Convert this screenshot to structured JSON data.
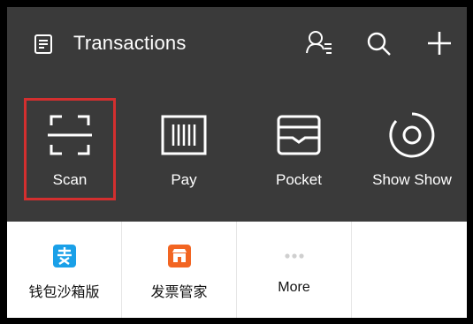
{
  "header": {
    "title": "Transactions",
    "icons": [
      "document-icon",
      "contacts-icon",
      "search-icon",
      "plus-icon"
    ]
  },
  "quick_actions": [
    {
      "label": "Scan",
      "icon": "scan-icon",
      "highlighted": true
    },
    {
      "label": "Pay",
      "icon": "barcode-icon"
    },
    {
      "label": "Pocket",
      "icon": "wallet-icon"
    },
    {
      "label": "Show Show",
      "icon": "show-icon"
    }
  ],
  "apps": [
    {
      "label": "钱包沙箱版",
      "icon": "alipay-icon",
      "color": "#1aa0e8"
    },
    {
      "label": "发票管家",
      "icon": "invoice-icon",
      "color": "#f26522"
    },
    {
      "label": "More",
      "icon": "more-dots-icon",
      "color": "#cfcfcf"
    }
  ],
  "colors": {
    "header_bg": "#3a3a3a",
    "highlight": "#d32f2f"
  }
}
